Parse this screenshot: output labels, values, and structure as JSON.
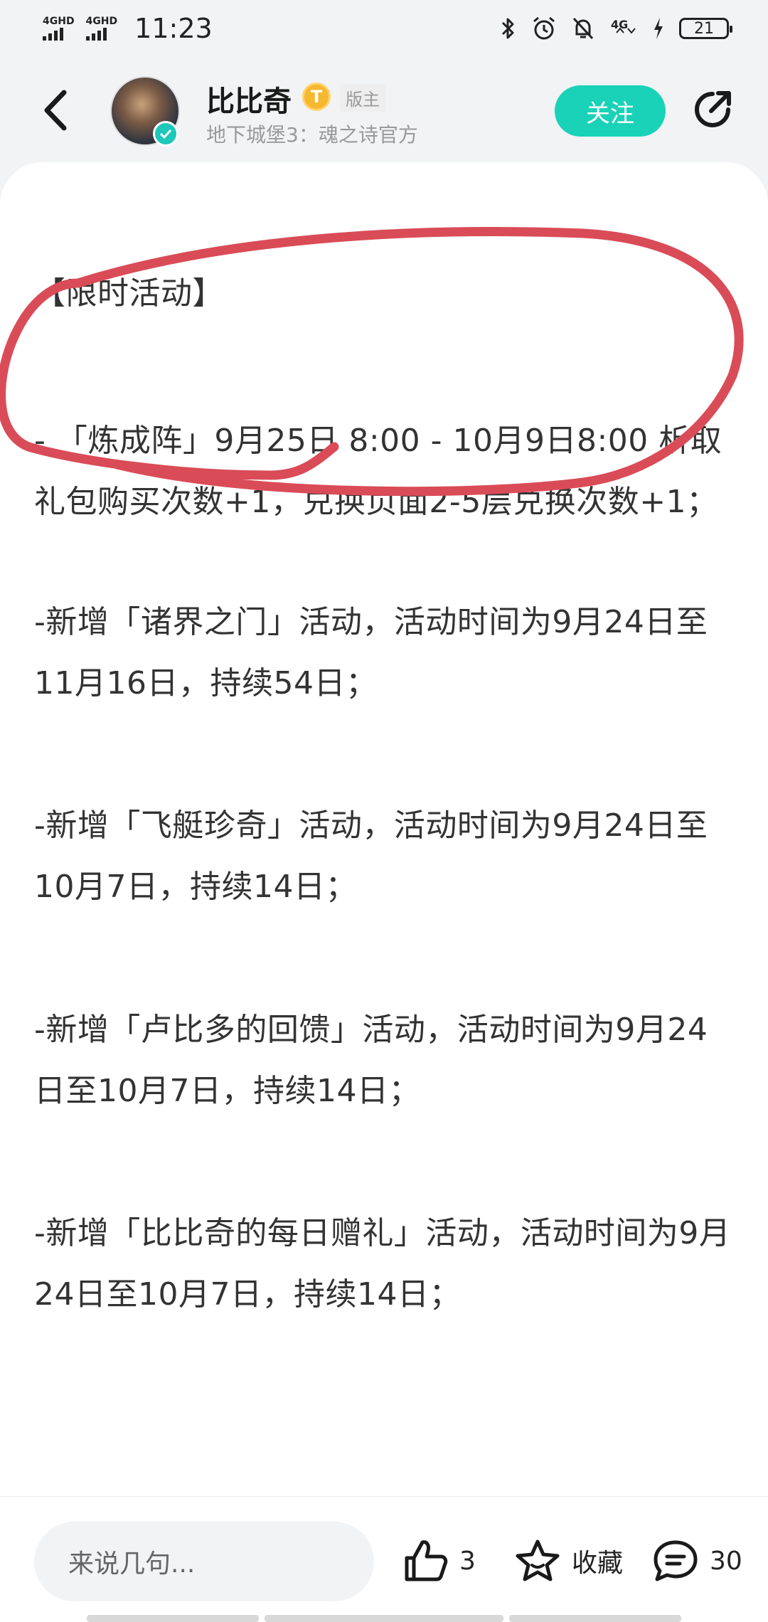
{
  "status_bar": {
    "signal_1": "4GHD",
    "signal_2": "4GHD",
    "time": "11:23",
    "network": "4G",
    "battery": "21"
  },
  "header": {
    "author_name": "比比奇",
    "level_badge": "T",
    "role_tag": "版主",
    "subtitle": "地下城堡3：魂之诗官方",
    "follow_label": "关注"
  },
  "post": {
    "paragraphs": [
      "【限时活动】",
      "- 「炼成阵」9月25日 8:00 - 10月9日8:00 析取礼包购买次数+1，兑换页面2-5层兑换次数+1；",
      "-新增「诸界之门」活动，活动时间为9月24日至11月16日，持续54日；",
      "-新增「飞艇珍奇」活动，活动时间为9月24日至10月7日，持续14日；",
      "-新增「卢比多的回馈」活动，活动时间为9月24日至10月7日，持续14日；",
      "-新增「比比奇的每日赠礼」活动，活动时间为9月24日至10月7日，持续14日；"
    ],
    "highlight_color": "#d94c57"
  },
  "bottom_bar": {
    "comment_placeholder": "来说几句...",
    "like_count": "3",
    "favorite_label": "收藏",
    "comment_count": "30"
  },
  "colors": {
    "accent": "#19d2b8",
    "badge": "#f5b82e"
  }
}
